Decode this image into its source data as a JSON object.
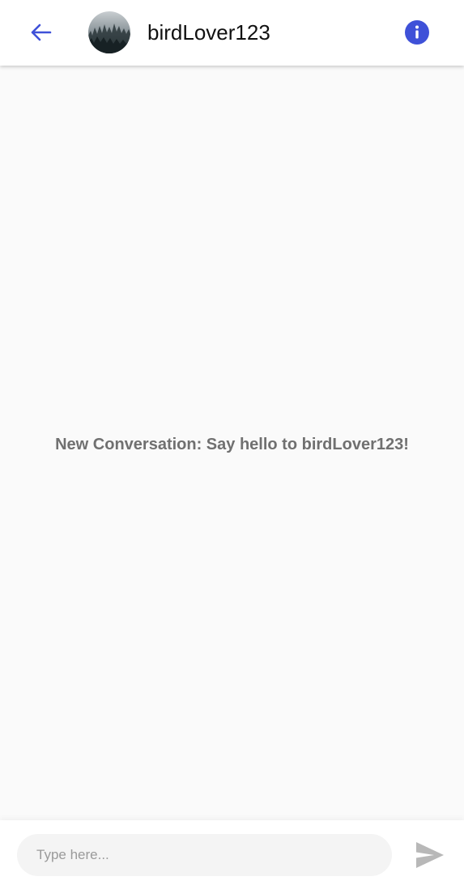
{
  "header": {
    "username": "birdLover123",
    "back_icon": "arrow-left-icon",
    "info_icon": "info-icon",
    "accent_color": "#3f51d8"
  },
  "conversation": {
    "empty_message": "New Conversation: Say hello to birdLover123!"
  },
  "composer": {
    "placeholder": "Type here...",
    "value": "",
    "send_icon": "send-icon",
    "send_color": "#b8b8b8"
  }
}
